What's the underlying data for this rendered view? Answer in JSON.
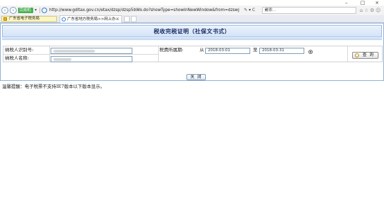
{
  "window": {
    "minimize": "–",
    "maximize": "□",
    "close": "×"
  },
  "address_bar": {
    "compat_label": "完成机关",
    "url": "http://www.gdltax.gov.cn/etax/dzsp/dzsp5bWo.do?showType=showInNewWindow&from=dzswj",
    "search_placeholder": "搜索...",
    "url_tools": "✎ ▾ C",
    "search_icon": "🔍",
    "right_icons": "⌂☆⚙☺"
  },
  "favorites": {
    "item_label": "广东省电子税务局"
  },
  "tabs": [
    {
      "label": "广东省地方税务局>>网上办...",
      "active": true
    }
  ],
  "page": {
    "title": "税收完税证明（社保文书式）",
    "fields": {
      "taxpayer_id_label": "纳税人识别号:",
      "taxpayer_name_label": "纳税人名称:",
      "period_label": "税费所属期:",
      "from_label": "从",
      "to_label": "至",
      "date_from": "2018-03-01",
      "date_to": "2018-03-31"
    },
    "query_button": "查 询",
    "close_button": "关 闭",
    "notice": "温馨提醒：电子税票不支持IE7版本以下版本显示。"
  }
}
